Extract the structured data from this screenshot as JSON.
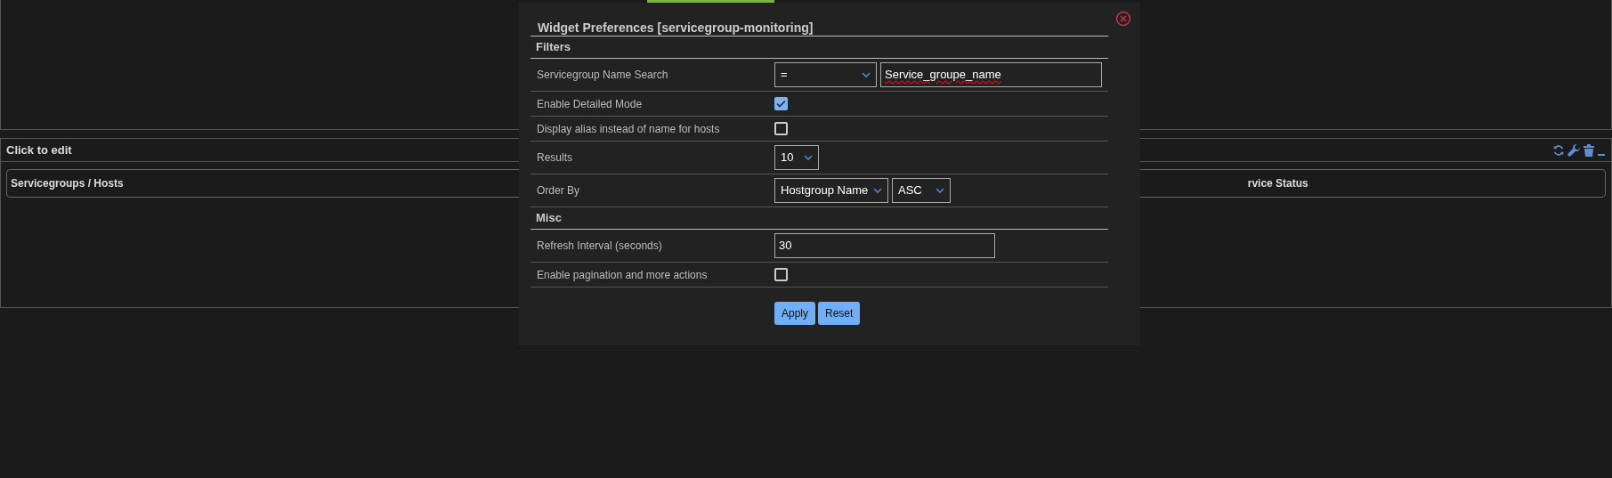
{
  "widget": {
    "title": "Click to edit",
    "columns": [
      "Servicegroups / Hosts",
      "rvice Status"
    ]
  },
  "dialog": {
    "title": "Widget Preferences [servicegroup-monitoring]",
    "sections": [
      {
        "title": "Filters",
        "rows": [
          {
            "kind": "search",
            "label": "Servicegroup Name Search",
            "operator": "=",
            "value": "Service_groupe_name"
          },
          {
            "kind": "checkbox",
            "label": "Enable Detailed Mode",
            "checked": true
          },
          {
            "kind": "checkbox",
            "label": "Display alias instead of name for hosts",
            "checked": false
          },
          {
            "kind": "select",
            "label": "Results",
            "options": [
              "10"
            ]
          },
          {
            "kind": "select",
            "label": "Order By",
            "options": [
              "Hostgroup Name",
              "ASC"
            ]
          }
        ]
      },
      {
        "title": "Misc",
        "rows": [
          {
            "kind": "text",
            "label": "Refresh Interval (seconds)",
            "value": "30"
          },
          {
            "kind": "checkbox",
            "label": "Enable pagination and more actions",
            "checked": false
          }
        ]
      }
    ],
    "buttons": [
      "Apply",
      "Reset"
    ]
  }
}
